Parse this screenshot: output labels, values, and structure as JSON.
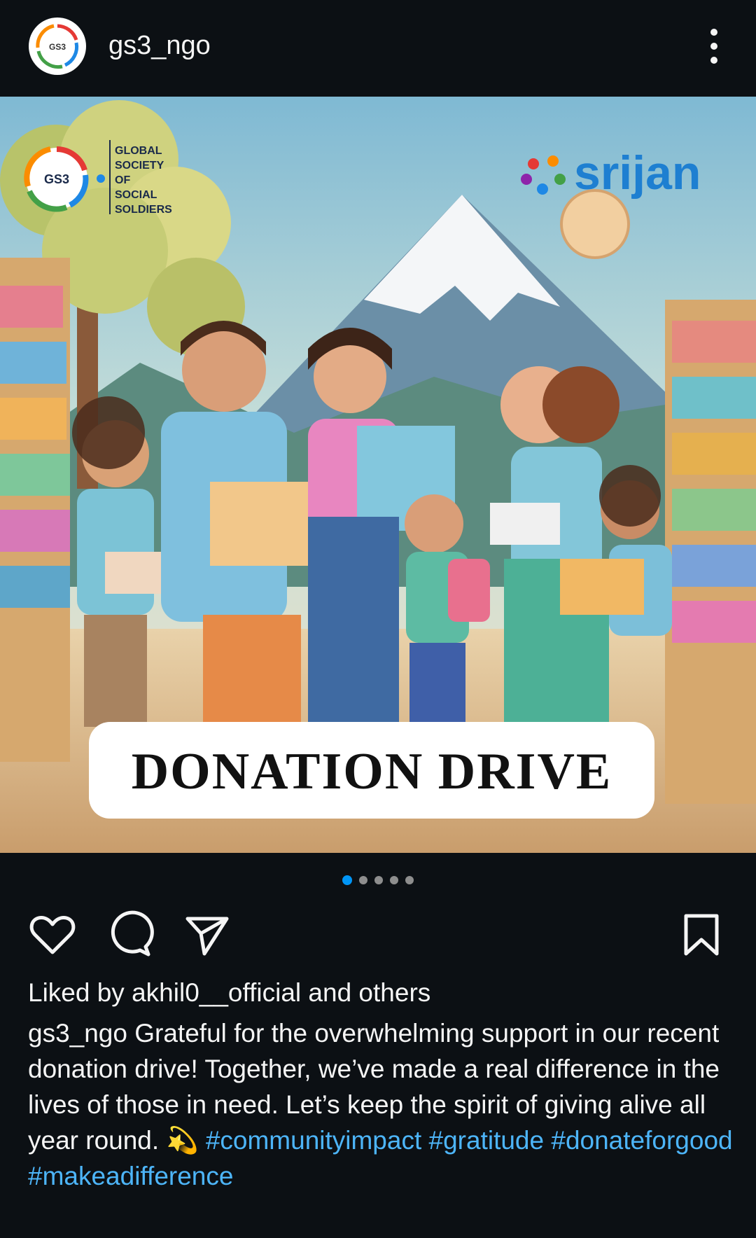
{
  "header": {
    "username": "gs3_ngo",
    "avatar_text": "GS3"
  },
  "post": {
    "ngo_logo_text": "GS3",
    "ngo_name_lines": [
      "GLOBAL",
      "SOCIETY",
      "OF",
      "SOCIAL",
      "SOLDIERS"
    ],
    "partner_logo": "srijan",
    "banner_text": "DONATION DRIVE"
  },
  "carousel": {
    "count": 5,
    "active": 1
  },
  "actions": {
    "like_icon": "heart-icon",
    "comment_icon": "comment-icon",
    "share_icon": "send-icon",
    "save_icon": "bookmark-icon"
  },
  "likes": {
    "prefix": "Liked by ",
    "user": "akhil0__official",
    "suffix": " and others"
  },
  "caption": {
    "username": "gs3_ngo",
    "text": "Grateful for the overwhelming support in our recent donation drive! Together, we’ve made a real difference in the lives of those in need. Let’s keep the spirit of giving alive all year round. 💫",
    "hashtags": "#communityimpact #gratitude #donateforgood #makeadifference"
  },
  "colors": {
    "background": "#0c1014",
    "accent": "#0095f6",
    "hashtag": "#4db5f9"
  }
}
